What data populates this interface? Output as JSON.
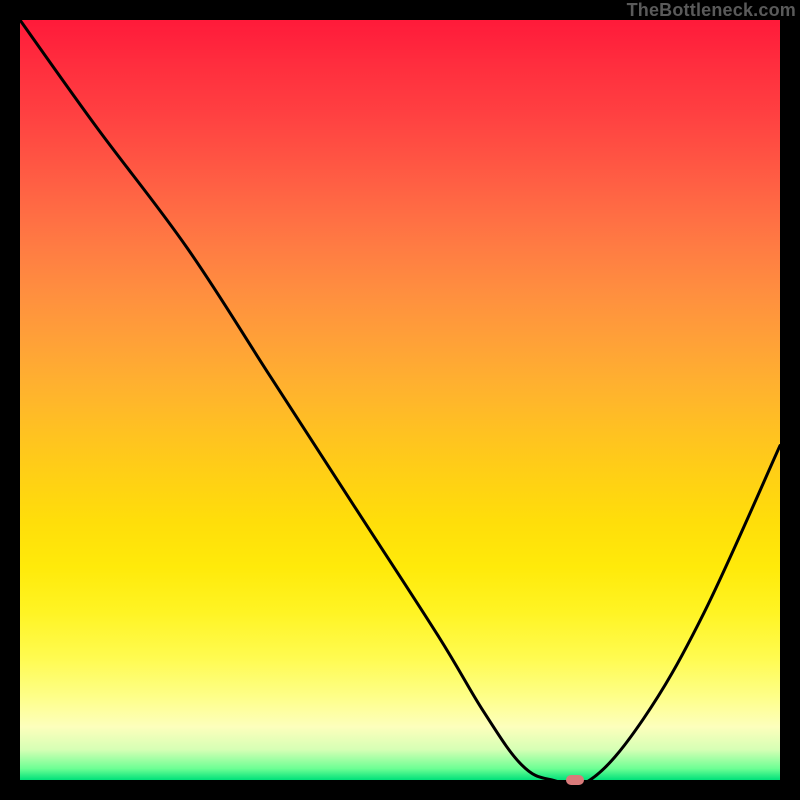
{
  "watermark": {
    "text": "TheBottleneck.com"
  },
  "colors": {
    "frame_bg": "#000000",
    "curve": "#000000",
    "marker": "#d97a7a"
  },
  "chart_data": {
    "type": "line",
    "title": "",
    "xlabel": "",
    "ylabel": "",
    "xlim": [
      0,
      100
    ],
    "ylim": [
      0,
      100
    ],
    "grid": false,
    "series": [
      {
        "name": "bottleneck-curve",
        "x": [
          0,
          10,
          22,
          33,
          44,
          55,
          61,
          66,
          70,
          75,
          82,
          90,
          100
        ],
        "values": [
          100,
          86,
          70,
          53,
          36,
          19,
          9,
          2,
          0,
          0,
          8,
          22,
          44
        ]
      }
    ],
    "marker": {
      "x": 73,
      "y": 0,
      "label": ""
    },
    "annotations": []
  }
}
